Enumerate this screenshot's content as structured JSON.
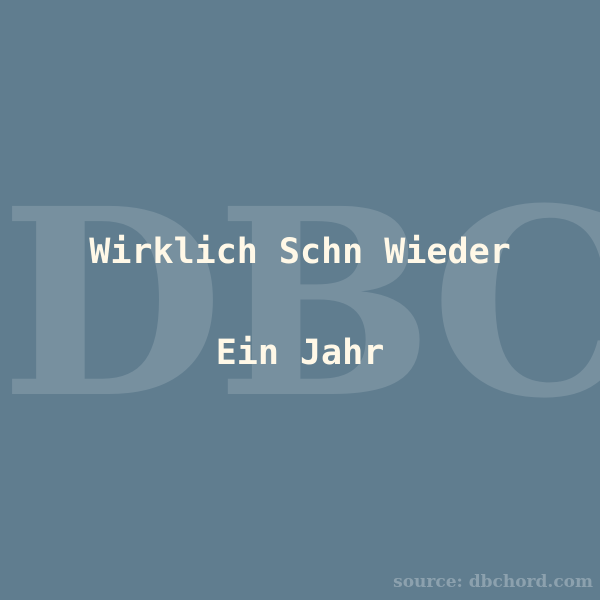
{
  "watermark": "DBC",
  "title": "Wirklich Schn Wieder",
  "subtitle": "Ein Jahr",
  "source": "source: dbchord.com",
  "colors": {
    "background": "#607d8f",
    "text": "#fff8e7"
  }
}
